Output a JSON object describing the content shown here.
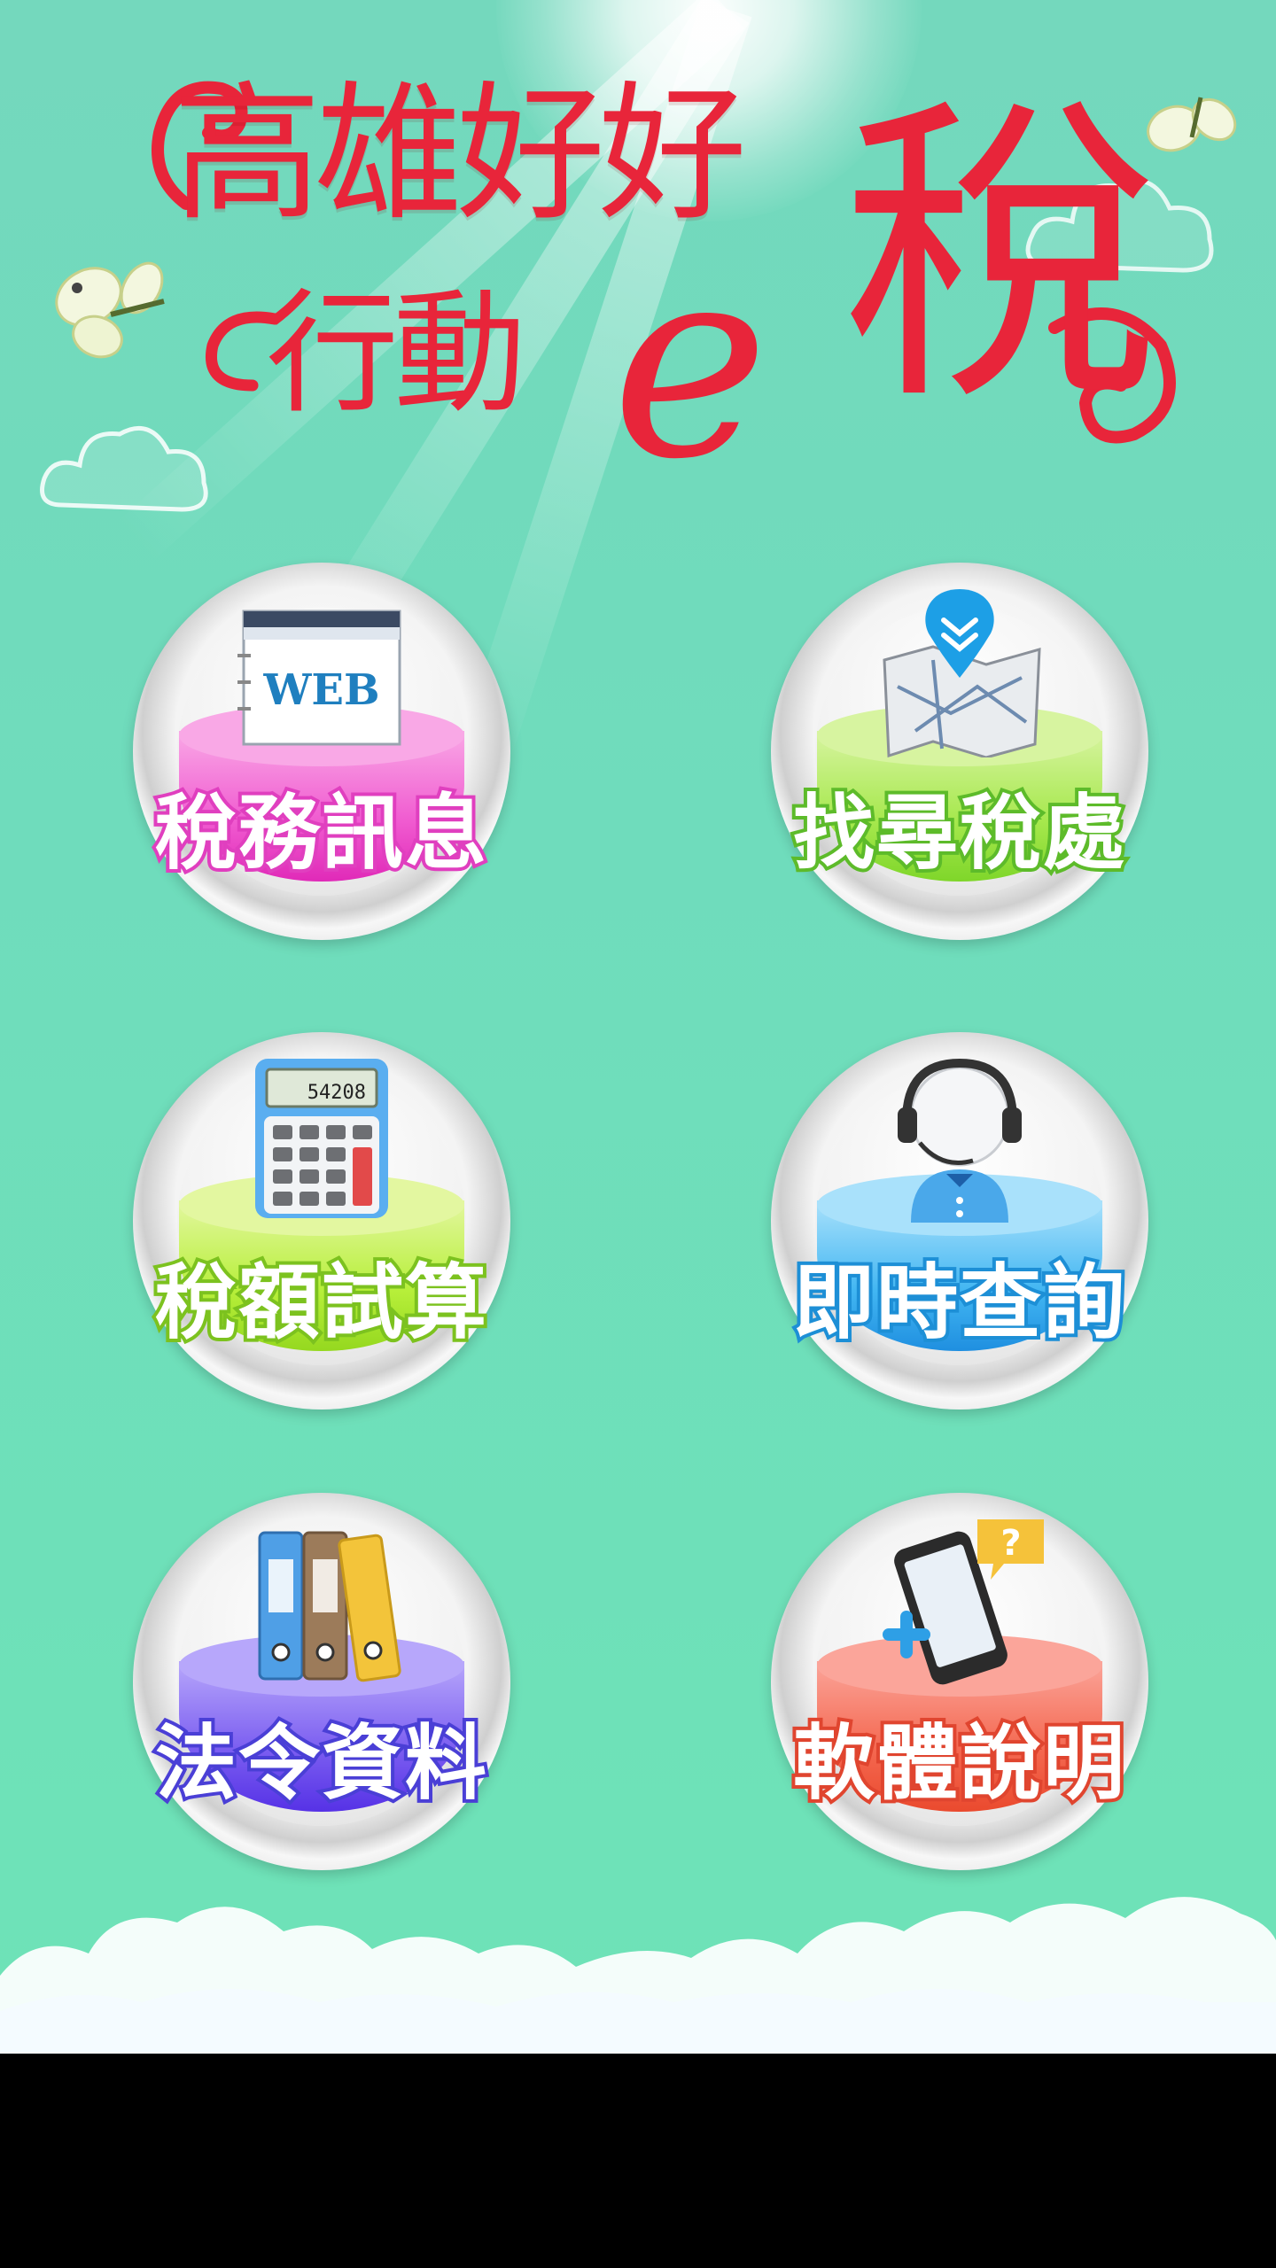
{
  "app": {
    "logo_line1": "高雄好好",
    "logo_line2": "行動",
    "logo_e": "e",
    "logo_tax": "稅",
    "logo_color": "#e8253a"
  },
  "menu": [
    {
      "label": "稅務訊息",
      "icon": "web-browser-icon",
      "cyl_color": "#f05bd0",
      "cyl_top": "#f9a8e6",
      "stroke": "#e03fbf"
    },
    {
      "label": "找尋稅處",
      "icon": "map-pin-icon",
      "cyl_color": "#a6e84d",
      "cyl_top": "#d7f4a0",
      "stroke": "#5dbb2a"
    },
    {
      "label": "稅額試算",
      "icon": "calculator-icon",
      "cyl_color": "#b7ef3a",
      "cyl_top": "#e3f7a0",
      "stroke": "#7cc21f"
    },
    {
      "label": "即時查詢",
      "icon": "customer-service-headset-icon",
      "cyl_color": "#42b6f2",
      "cyl_top": "#a9e1fb",
      "stroke": "#1d8fd6"
    },
    {
      "label": "法令資料",
      "icon": "binders-icon",
      "cyl_color": "#7a5cf0",
      "cyl_top": "#b7a7fb",
      "stroke": "#4a3fd6"
    },
    {
      "label": "軟體說明",
      "icon": "smartphone-help-icon",
      "cyl_color": "#f4674f",
      "cyl_top": "#fba59a",
      "stroke": "#e0452f"
    }
  ]
}
